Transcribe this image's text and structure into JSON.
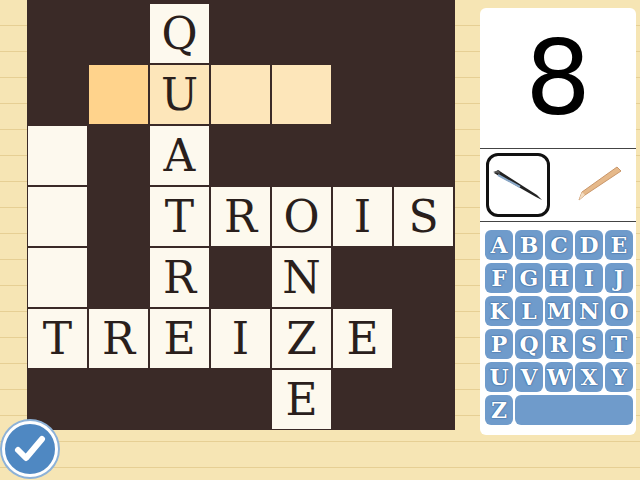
{
  "clue_number": "8",
  "grid": [
    [
      {
        "kind": "block",
        "letter": "",
        "selected": false,
        "in_word": false
      },
      {
        "kind": "block",
        "letter": "",
        "selected": false,
        "in_word": false
      },
      {
        "kind": "cell",
        "letter": "Q",
        "selected": false,
        "in_word": false
      },
      {
        "kind": "block",
        "letter": "",
        "selected": false,
        "in_word": false
      },
      {
        "kind": "block",
        "letter": "",
        "selected": false,
        "in_word": false
      },
      {
        "kind": "block",
        "letter": "",
        "selected": false,
        "in_word": false
      },
      {
        "kind": "block",
        "letter": "",
        "selected": false,
        "in_word": false
      }
    ],
    [
      {
        "kind": "block",
        "letter": "",
        "selected": false,
        "in_word": false
      },
      {
        "kind": "cell",
        "letter": "",
        "selected": true,
        "in_word": true
      },
      {
        "kind": "cell",
        "letter": "U",
        "selected": false,
        "in_word": true
      },
      {
        "kind": "cell",
        "letter": "",
        "selected": false,
        "in_word": true
      },
      {
        "kind": "cell",
        "letter": "",
        "selected": false,
        "in_word": true
      },
      {
        "kind": "block",
        "letter": "",
        "selected": false,
        "in_word": false
      },
      {
        "kind": "block",
        "letter": "",
        "selected": false,
        "in_word": false
      }
    ],
    [
      {
        "kind": "cell",
        "letter": "",
        "selected": false,
        "in_word": false
      },
      {
        "kind": "block",
        "letter": "",
        "selected": false,
        "in_word": false
      },
      {
        "kind": "cell",
        "letter": "A",
        "selected": false,
        "in_word": false
      },
      {
        "kind": "block",
        "letter": "",
        "selected": false,
        "in_word": false
      },
      {
        "kind": "block",
        "letter": "",
        "selected": false,
        "in_word": false
      },
      {
        "kind": "block",
        "letter": "",
        "selected": false,
        "in_word": false
      },
      {
        "kind": "block",
        "letter": "",
        "selected": false,
        "in_word": false
      }
    ],
    [
      {
        "kind": "cell",
        "letter": "",
        "selected": false,
        "in_word": false
      },
      {
        "kind": "block",
        "letter": "",
        "selected": false,
        "in_word": false
      },
      {
        "kind": "cell",
        "letter": "T",
        "selected": false,
        "in_word": false
      },
      {
        "kind": "cell",
        "letter": "R",
        "selected": false,
        "in_word": false
      },
      {
        "kind": "cell",
        "letter": "O",
        "selected": false,
        "in_word": false
      },
      {
        "kind": "cell",
        "letter": "I",
        "selected": false,
        "in_word": false
      },
      {
        "kind": "cell",
        "letter": "S",
        "selected": false,
        "in_word": false
      }
    ],
    [
      {
        "kind": "cell",
        "letter": "",
        "selected": false,
        "in_word": false
      },
      {
        "kind": "block",
        "letter": "",
        "selected": false,
        "in_word": false
      },
      {
        "kind": "cell",
        "letter": "R",
        "selected": false,
        "in_word": false
      },
      {
        "kind": "block",
        "letter": "",
        "selected": false,
        "in_word": false
      },
      {
        "kind": "cell",
        "letter": "N",
        "selected": false,
        "in_word": false
      },
      {
        "kind": "block",
        "letter": "",
        "selected": false,
        "in_word": false
      },
      {
        "kind": "block",
        "letter": "",
        "selected": false,
        "in_word": false
      }
    ],
    [
      {
        "kind": "cell",
        "letter": "T",
        "selected": false,
        "in_word": false
      },
      {
        "kind": "cell",
        "letter": "R",
        "selected": false,
        "in_word": false
      },
      {
        "kind": "cell",
        "letter": "E",
        "selected": false,
        "in_word": false
      },
      {
        "kind": "cell",
        "letter": "I",
        "selected": false,
        "in_word": false
      },
      {
        "kind": "cell",
        "letter": "Z",
        "selected": false,
        "in_word": false
      },
      {
        "kind": "cell",
        "letter": "E",
        "selected": false,
        "in_word": false
      },
      {
        "kind": "block",
        "letter": "",
        "selected": false,
        "in_word": false
      }
    ],
    [
      {
        "kind": "block",
        "letter": "",
        "selected": false,
        "in_word": false
      },
      {
        "kind": "block",
        "letter": "",
        "selected": false,
        "in_word": false
      },
      {
        "kind": "block",
        "letter": "",
        "selected": false,
        "in_word": false
      },
      {
        "kind": "block",
        "letter": "",
        "selected": false,
        "in_word": false
      },
      {
        "kind": "cell",
        "letter": "E",
        "selected": false,
        "in_word": false
      },
      {
        "kind": "block",
        "letter": "",
        "selected": false,
        "in_word": false
      },
      {
        "kind": "block",
        "letter": "",
        "selected": false,
        "in_word": false
      }
    ]
  ],
  "tools": [
    {
      "kind": "pen",
      "selected": true
    },
    {
      "kind": "pencil",
      "selected": false
    }
  ],
  "keys": [
    {
      "label": "A",
      "kind": "letter"
    },
    {
      "label": "B",
      "kind": "letter"
    },
    {
      "label": "C",
      "kind": "letter"
    },
    {
      "label": "D",
      "kind": "letter"
    },
    {
      "label": "E",
      "kind": "letter"
    },
    {
      "label": "F",
      "kind": "letter"
    },
    {
      "label": "G",
      "kind": "letter"
    },
    {
      "label": "H",
      "kind": "letter"
    },
    {
      "label": "I",
      "kind": "letter"
    },
    {
      "label": "J",
      "kind": "letter"
    },
    {
      "label": "K",
      "kind": "letter"
    },
    {
      "label": "L",
      "kind": "letter"
    },
    {
      "label": "M",
      "kind": "letter"
    },
    {
      "label": "N",
      "kind": "letter"
    },
    {
      "label": "O",
      "kind": "letter"
    },
    {
      "label": "P",
      "kind": "letter"
    },
    {
      "label": "Q",
      "kind": "letter"
    },
    {
      "label": "R",
      "kind": "letter"
    },
    {
      "label": "S",
      "kind": "letter"
    },
    {
      "label": "T",
      "kind": "letter"
    },
    {
      "label": "U",
      "kind": "letter"
    },
    {
      "label": "V",
      "kind": "letter"
    },
    {
      "label": "W",
      "kind": "letter"
    },
    {
      "label": "X",
      "kind": "letter"
    },
    {
      "label": "Y",
      "kind": "letter"
    },
    {
      "label": "Z",
      "kind": "letter"
    },
    {
      "label": "",
      "kind": "space"
    }
  ]
}
